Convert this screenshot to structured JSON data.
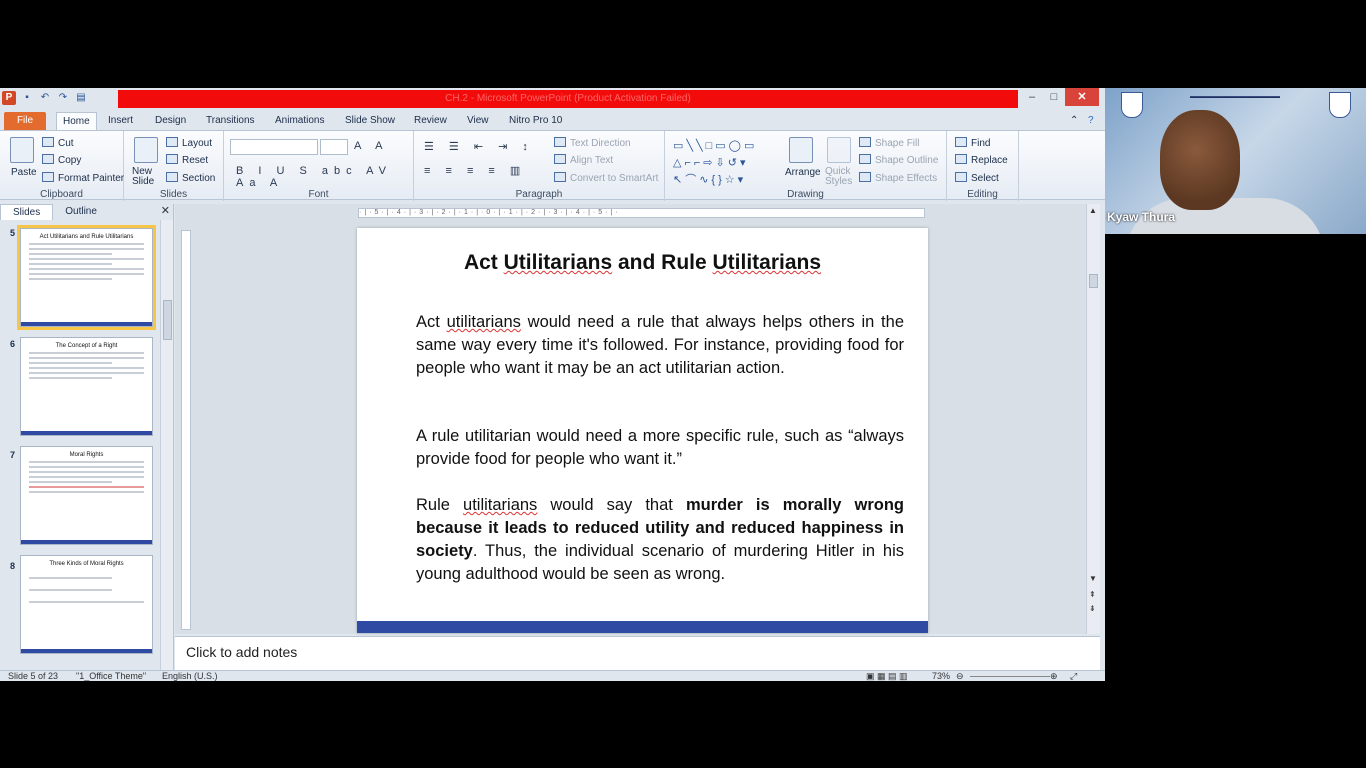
{
  "window": {
    "title_bar_text": "CH.2 - Microsoft PowerPoint (Product Activation Failed)",
    "quick_access": [
      "powerpoint-logo",
      "save-icon",
      "undo-icon",
      "redo-icon",
      "open-icon"
    ]
  },
  "ribbon": {
    "tabs": [
      "File",
      "Home",
      "Insert",
      "Design",
      "Transitions",
      "Animations",
      "Slide Show",
      "Review",
      "View",
      "Nitro Pro 10"
    ],
    "active_tab": "Home",
    "clipboard": {
      "paste": "Paste",
      "cut": "Cut",
      "copy": "Copy",
      "format_painter": "Format Painter",
      "label": "Clipboard"
    },
    "slides": {
      "new_slide": "New Slide",
      "layout": "Layout",
      "reset": "Reset",
      "section": "Section",
      "label": "Slides"
    },
    "font": {
      "label": "Font",
      "buttons": "B I U S abc AV Aa A"
    },
    "paragraph": {
      "text_direction": "Text Direction",
      "align_text": "Align Text",
      "convert_smartart": "Convert to SmartArt",
      "label": "Paragraph"
    },
    "drawing": {
      "arrange": "Arrange",
      "quick_styles": "Quick Styles",
      "shape_fill": "Shape Fill",
      "shape_outline": "Shape Outline",
      "shape_effects": "Shape Effects",
      "label": "Drawing"
    },
    "editing": {
      "find": "Find",
      "replace": "Replace",
      "select": "Select",
      "label": "Editing"
    }
  },
  "slide_pane": {
    "tabs": [
      "Slides",
      "Outline"
    ],
    "thumbnails": [
      {
        "number": "5",
        "title": "Act Utilitarians and Rule Utilitarians",
        "selected": true
      },
      {
        "number": "6",
        "title": "The Concept of a Right",
        "selected": false
      },
      {
        "number": "7",
        "title": "Moral Rights",
        "selected": false
      },
      {
        "number": "8",
        "title": "Three Kinds of Moral Rights",
        "selected": false
      }
    ]
  },
  "slide": {
    "title_parts": [
      "Act ",
      "Utilitarians",
      " and Rule ",
      "Utilitarians"
    ],
    "p1": {
      "a": "Act ",
      "u1": "utilitarians",
      "b": " would need a rule that always helps others in the same way every time it's followed. For instance, providing food for people who want it may be an act utilitarian action."
    },
    "p2": " A rule utilitarian would need a more specific rule, such as “always provide food for people who want it.”",
    "p3": {
      "a": "Rule ",
      "u1": "utilitarians",
      "b": " would say that ",
      "bold": "murder is morally wrong because it leads to reduced utility and reduced happiness in society",
      "c": ". Thus, the individual scenario of murdering Hitler in his young adulthood would be seen as wrong."
    }
  },
  "notes": {
    "placeholder": "Click to add notes"
  },
  "status": {
    "slide": "Slide 5 of 23",
    "theme": "\"1_Office Theme\"",
    "language": "English (U.S.)",
    "zoom": "73%"
  },
  "video": {
    "participant_name": "Kyaw Thura"
  },
  "colors": {
    "file_tab": "#e46b2e",
    "title_bar_highlight": "#f10b0b",
    "slide_bar": "#2f4aa3",
    "selected_thumb": "#f7c548"
  }
}
